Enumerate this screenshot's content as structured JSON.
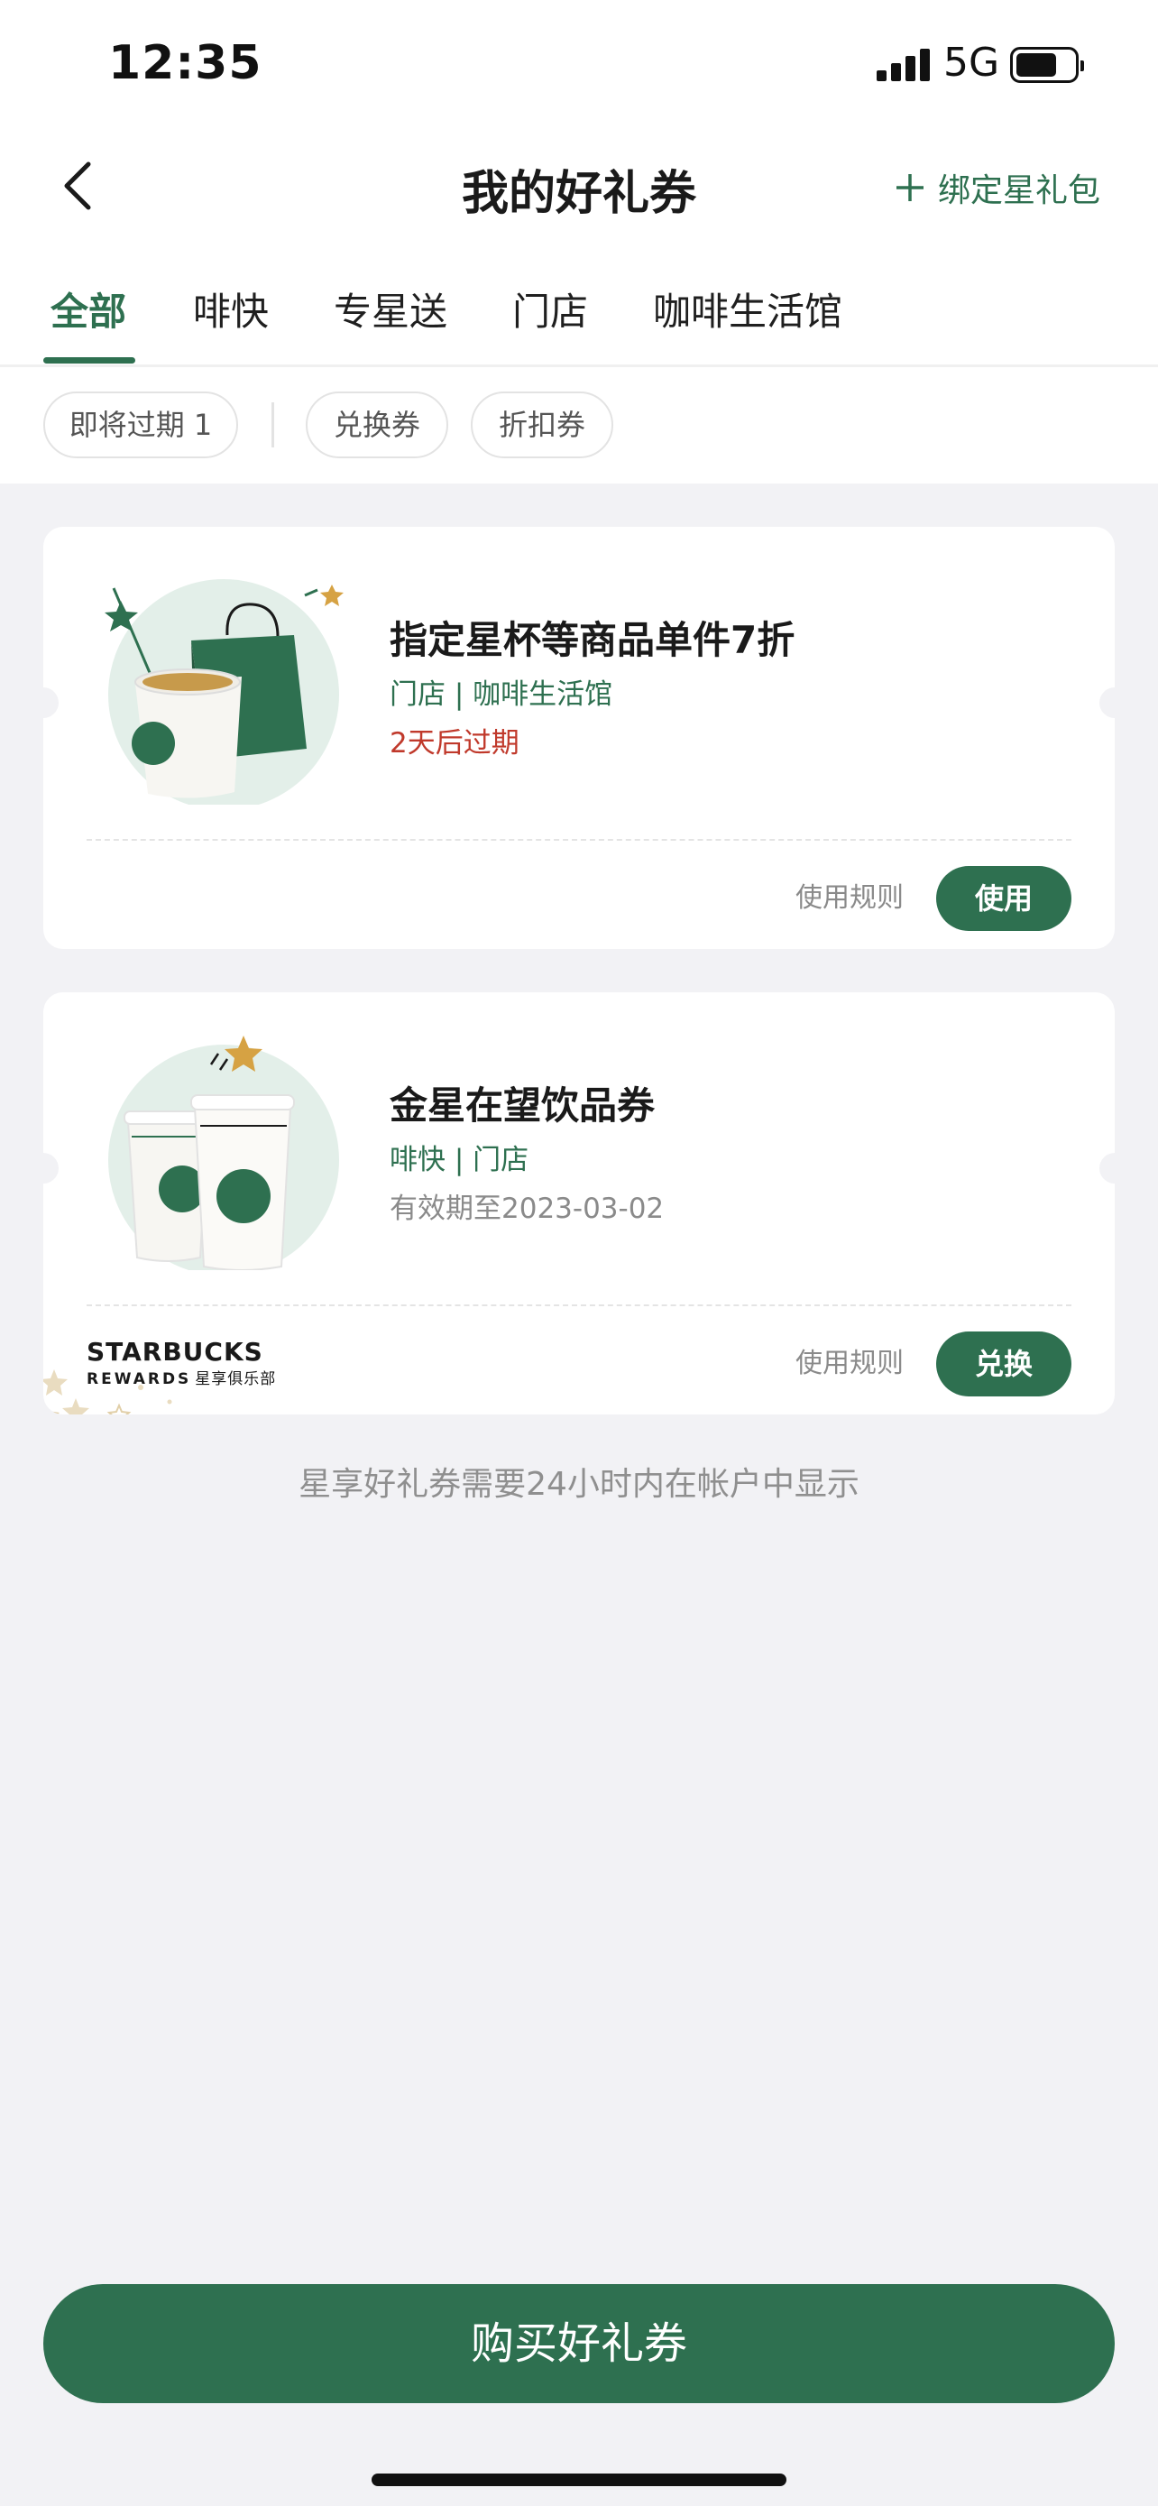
{
  "status_bar": {
    "time": "12:35",
    "network": "5G"
  },
  "header": {
    "title": "我的好礼券",
    "bind_label": "绑定星礼包"
  },
  "tabs": [
    {
      "label": "全部",
      "active": true
    },
    {
      "label": "啡快",
      "active": false
    },
    {
      "label": "专星送",
      "active": false
    },
    {
      "label": "门店",
      "active": false
    },
    {
      "label": "咖啡生活馆",
      "active": false
    }
  ],
  "filters": [
    {
      "label": "即将过期 1"
    },
    {
      "label": "兑换券"
    },
    {
      "label": "折扣券"
    }
  ],
  "coupons": [
    {
      "title": "指定星杯等商品单件7折",
      "channels": "门店 | 咖啡生活馆",
      "expiry": "2天后过期",
      "rules_label": "使用规则",
      "action_label": "使用",
      "illustration": "cup-and-bag-illustration"
    },
    {
      "title": "金星在望饮品券",
      "channels": "啡快 | 门店",
      "expiry": "有效期至2023-03-02",
      "rules_label": "使用规则",
      "action_label": "兑换",
      "illustration": "two-cups-illustration",
      "brand": {
        "name": "STARBUCKS",
        "sub": "REWARDS",
        "sub_cn": "星享俱乐部"
      }
    }
  ],
  "note": "星享好礼券需要24小时内在帐户中显示",
  "buy_button": "购买好礼券",
  "colors": {
    "brand_green": "#2e7050",
    "expiry_red": "#c0392b",
    "background": "#f2f2f5"
  }
}
